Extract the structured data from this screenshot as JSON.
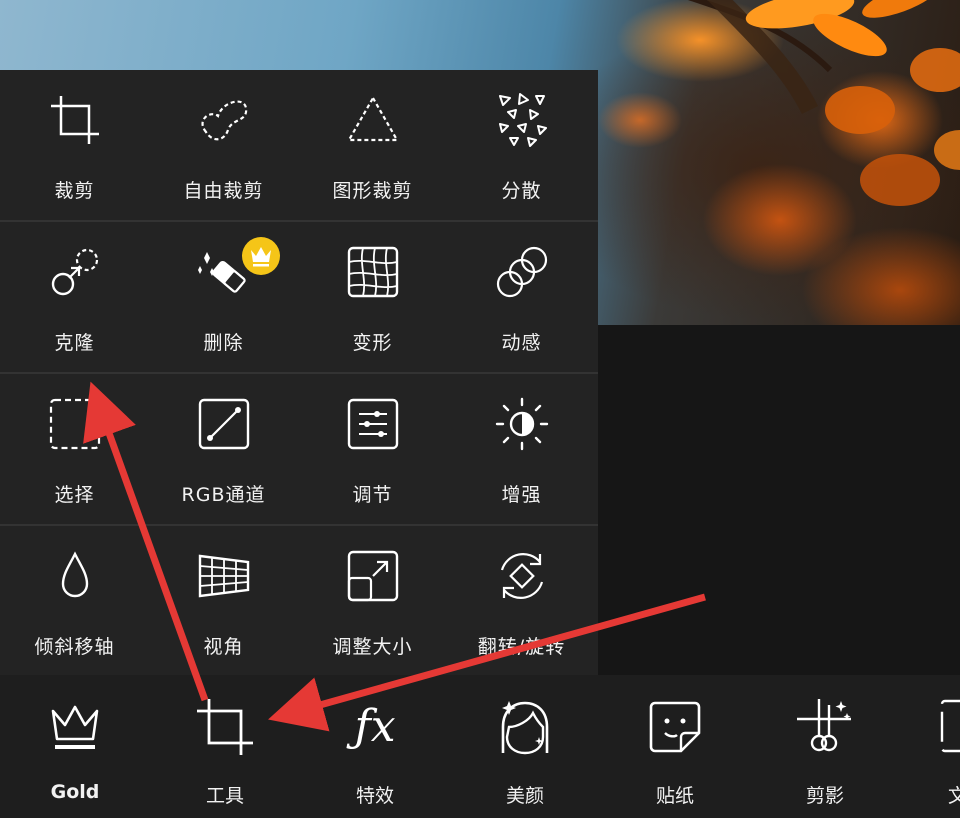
{
  "tools": {
    "row1": [
      {
        "label": "裁剪",
        "icon": "crop-icon"
      },
      {
        "label": "自由裁剪",
        "icon": "freeform-crop-icon"
      },
      {
        "label": "图形裁剪",
        "icon": "shape-crop-icon"
      },
      {
        "label": "分散",
        "icon": "disperse-icon"
      }
    ],
    "row2": [
      {
        "label": "克隆",
        "icon": "clone-icon"
      },
      {
        "label": "删除",
        "icon": "eraser-icon",
        "badge": "crown-badge"
      },
      {
        "label": "变形",
        "icon": "warp-icon"
      },
      {
        "label": "动感",
        "icon": "motion-icon"
      }
    ],
    "row3": [
      {
        "label": "选择",
        "icon": "selection-icon"
      },
      {
        "label": "RGB通道",
        "icon": "rgb-channel-icon"
      },
      {
        "label": "调节",
        "icon": "adjust-icon"
      },
      {
        "label": "增强",
        "icon": "enhance-icon"
      }
    ],
    "row4": [
      {
        "label": "倾斜移轴",
        "icon": "tilt-shift-icon"
      },
      {
        "label": "视角",
        "icon": "perspective-icon"
      },
      {
        "label": "调整大小",
        "icon": "resize-icon"
      },
      {
        "label": "翻转/旋转",
        "icon": "flip-rotate-icon"
      }
    ]
  },
  "bottom_bar": [
    {
      "label": "Gold",
      "icon": "crown-icon"
    },
    {
      "label": "工具",
      "icon": "crop-tool-icon"
    },
    {
      "label": "特效",
      "icon": "fx-icon"
    },
    {
      "label": "美颜",
      "icon": "face-beauty-icon"
    },
    {
      "label": "贴纸",
      "icon": "sticker-icon"
    },
    {
      "label": "剪影",
      "icon": "cutout-icon"
    },
    {
      "label": "文",
      "icon": "text-icon"
    }
  ],
  "colors": {
    "panel": "#232323",
    "bar": "#1e1e1e",
    "annotation_arrow": "#e53935",
    "crown_badge": "#f5c518"
  }
}
